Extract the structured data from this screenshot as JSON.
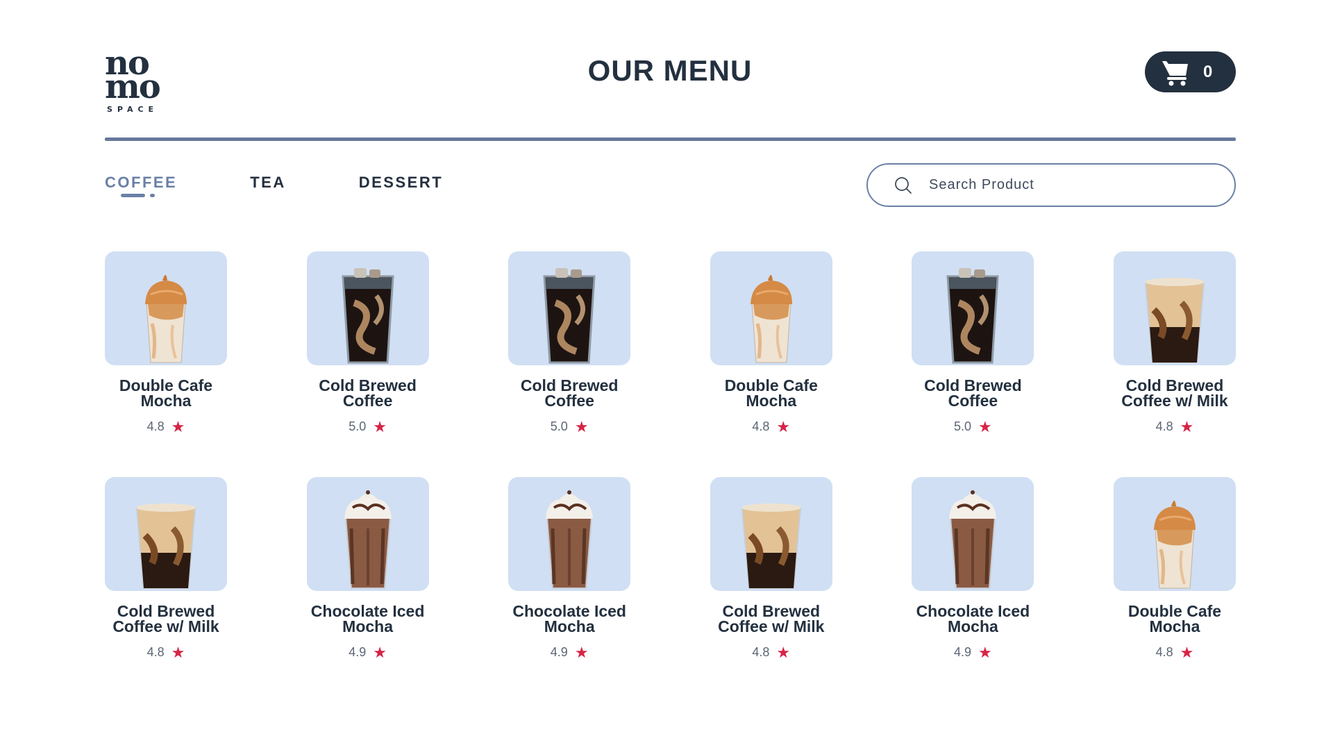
{
  "brand": {
    "logo_line1": "no",
    "logo_line2": "mo",
    "logo_line3": "SPACE"
  },
  "header": {
    "title": "OUR MENU",
    "cart_count": "0"
  },
  "tabs": [
    {
      "label": "COFFEE",
      "active": true
    },
    {
      "label": "TEA",
      "active": false
    },
    {
      "label": "DESSERT",
      "active": false
    }
  ],
  "search": {
    "placeholder": "Search Product",
    "value": ""
  },
  "colors": {
    "accent": "#6a80a6",
    "dark": "#23303f",
    "card_bg": "#d0dff3",
    "star": "#d62447"
  },
  "products": [
    {
      "name": "Double Cafe Mocha",
      "rating": "4.8",
      "image": "dalgona-icon"
    },
    {
      "name": "Cold Brewed Coffee",
      "rating": "5.0",
      "image": "cold-brew-icon"
    },
    {
      "name": "Cold Brewed Coffee",
      "rating": "5.0",
      "image": "cold-brew-icon"
    },
    {
      "name": "Double Cafe Mocha",
      "rating": "4.8",
      "image": "dalgona-icon"
    },
    {
      "name": "Cold Brewed Coffee",
      "rating": "5.0",
      "image": "cold-brew-icon"
    },
    {
      "name": "Cold Brewed Coffee w/ Milk",
      "rating": "4.8",
      "image": "iced-latte-icon"
    },
    {
      "name": "Cold Brewed Coffee w/ Milk",
      "rating": "4.8",
      "image": "iced-latte-icon"
    },
    {
      "name": "Chocolate Iced Mocha",
      "rating": "4.9",
      "image": "iced-mocha-icon"
    },
    {
      "name": "Chocolate Iced Mocha",
      "rating": "4.9",
      "image": "iced-mocha-icon"
    },
    {
      "name": "Cold Brewed Coffee w/ Milk",
      "rating": "4.8",
      "image": "iced-latte-icon"
    },
    {
      "name": "Chocolate Iced Mocha",
      "rating": "4.9",
      "image": "iced-mocha-icon"
    },
    {
      "name": "Double Cafe Mocha",
      "rating": "4.8",
      "image": "dalgona-icon"
    }
  ]
}
